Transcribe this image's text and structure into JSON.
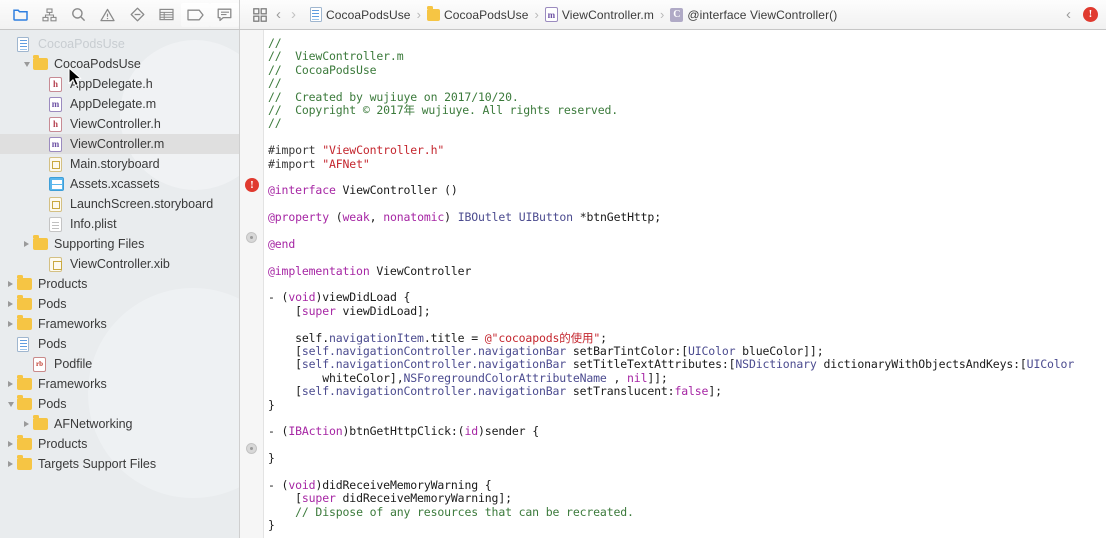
{
  "toolbar": {
    "icons": [
      {
        "name": "project-navigator-icon",
        "label": "Project Navigator",
        "active": true
      },
      {
        "name": "symbol-navigator-icon",
        "label": "Symbol Navigator",
        "active": false
      },
      {
        "name": "find-navigator-icon",
        "label": "Find Navigator",
        "active": false
      },
      {
        "name": "issue-navigator-icon",
        "label": "Issue Navigator",
        "active": false
      },
      {
        "name": "test-navigator-icon",
        "label": "Test Navigator",
        "active": false
      },
      {
        "name": "debug-navigator-icon",
        "label": "Debug Navigator",
        "active": false
      },
      {
        "name": "breakpoint-navigator-icon",
        "label": "Breakpoint Navigator",
        "active": false
      },
      {
        "name": "report-navigator-icon",
        "label": "Report Navigator",
        "active": false
      }
    ]
  },
  "jumpbar": {
    "related_items_label": "Related Items",
    "back_label": "Back",
    "forward_label": "Forward",
    "breadcrumbs": [
      {
        "label": "CocoaPodsUse",
        "icon": "project-icon"
      },
      {
        "label": "CocoaPodsUse",
        "icon": "folder-icon"
      },
      {
        "label": "ViewController.m",
        "icon": "objc-implementation-icon"
      },
      {
        "label": "@interface ViewController()",
        "icon": "class-icon"
      }
    ],
    "separator": "›",
    "issue_prev_label": "Previous Issue",
    "error_count": "!"
  },
  "sidebar": {
    "items": [
      {
        "label": "CocoaPodsUse",
        "indent": 0,
        "icon": "project-icon",
        "disclosure": "none",
        "selected": false,
        "faded": true
      },
      {
        "label": "CocoaPodsUse",
        "indent": 1,
        "icon": "folder-icon",
        "disclosure": "open",
        "selected": false,
        "faded": false
      },
      {
        "label": "AppDelegate.h",
        "indent": 2,
        "icon": "objc-header-icon",
        "disclosure": "none",
        "selected": false,
        "faded": false
      },
      {
        "label": "AppDelegate.m",
        "indent": 2,
        "icon": "objc-implementation-icon",
        "disclosure": "none",
        "selected": false,
        "faded": false
      },
      {
        "label": "ViewController.h",
        "indent": 2,
        "icon": "objc-header-icon",
        "disclosure": "none",
        "selected": false,
        "faded": false
      },
      {
        "label": "ViewController.m",
        "indent": 2,
        "icon": "objc-implementation-icon",
        "disclosure": "none",
        "selected": true,
        "faded": false
      },
      {
        "label": "Main.storyboard",
        "indent": 2,
        "icon": "storyboard-icon",
        "disclosure": "none",
        "selected": false,
        "faded": false
      },
      {
        "label": "Assets.xcassets",
        "indent": 2,
        "icon": "assets-icon",
        "disclosure": "none",
        "selected": false,
        "faded": false
      },
      {
        "label": "LaunchScreen.storyboard",
        "indent": 2,
        "icon": "storyboard-icon",
        "disclosure": "none",
        "selected": false,
        "faded": false
      },
      {
        "label": "Info.plist",
        "indent": 2,
        "icon": "plist-icon",
        "disclosure": "none",
        "selected": false,
        "faded": false
      },
      {
        "label": "Supporting Files",
        "indent": 1,
        "icon": "folder-icon",
        "disclosure": "closed",
        "selected": false,
        "faded": false
      },
      {
        "label": "ViewController.xib",
        "indent": 2,
        "icon": "xib-icon",
        "disclosure": "none",
        "selected": false,
        "faded": false
      },
      {
        "label": "Products",
        "indent": 0,
        "icon": "folder-icon",
        "disclosure": "closed",
        "selected": false,
        "faded": false
      },
      {
        "label": "Pods",
        "indent": 0,
        "icon": "folder-icon",
        "disclosure": "closed",
        "selected": false,
        "faded": false
      },
      {
        "label": "Frameworks",
        "indent": 0,
        "icon": "folder-icon",
        "disclosure": "closed",
        "selected": false,
        "faded": false
      },
      {
        "label": "Pods",
        "indent": 0,
        "icon": "project-icon",
        "disclosure": "none",
        "selected": false,
        "faded": false
      },
      {
        "label": "Podfile",
        "indent": 1,
        "icon": "ruby-icon",
        "disclosure": "none",
        "selected": false,
        "faded": false
      },
      {
        "label": "Frameworks",
        "indent": 0,
        "icon": "folder-icon",
        "disclosure": "closed",
        "selected": false,
        "faded": false
      },
      {
        "label": "Pods",
        "indent": 0,
        "icon": "folder-icon",
        "disclosure": "open",
        "selected": false,
        "faded": false
      },
      {
        "label": "AFNetworking",
        "indent": 1,
        "icon": "folder-icon",
        "disclosure": "closed",
        "selected": false,
        "faded": false
      },
      {
        "label": "Products",
        "indent": 0,
        "icon": "folder-icon",
        "disclosure": "closed",
        "selected": false,
        "faded": false
      },
      {
        "label": "Targets Support Files",
        "indent": 0,
        "icon": "folder-icon",
        "disclosure": "closed",
        "selected": false,
        "faded": false
      }
    ]
  },
  "editor": {
    "filename": "ViewController.m",
    "gutter": {
      "error_marker": "!",
      "breakpoint_dots": 2
    },
    "lines": [
      [
        [
          "cmt",
          "//"
        ]
      ],
      [
        [
          "cmt",
          "//  ViewController.m"
        ]
      ],
      [
        [
          "cmt",
          "//  CocoaPodsUse"
        ]
      ],
      [
        [
          "cmt",
          "//"
        ]
      ],
      [
        [
          "cmt",
          "//  Created by wujiuye on 2017/10/20."
        ]
      ],
      [
        [
          "cmt",
          "//  Copyright © 2017年 wujiuye. All rights reserved."
        ]
      ],
      [
        [
          "cmt",
          "//"
        ]
      ],
      [],
      [
        [
          "pre",
          "#import "
        ],
        [
          "str",
          "\"ViewController.h\""
        ]
      ],
      [
        [
          "pre",
          "#import "
        ],
        [
          "str",
          "\"AFNet\""
        ]
      ],
      [],
      [
        [
          "kw",
          "@interface"
        ],
        [
          "plain",
          " ViewController ()"
        ]
      ],
      [],
      [
        [
          "kw",
          "@property"
        ],
        [
          "plain",
          " ("
        ],
        [
          "kw",
          "weak"
        ],
        [
          "plain",
          ", "
        ],
        [
          "kw",
          "nonatomic"
        ],
        [
          "plain",
          ") "
        ],
        [
          "typ",
          "IBOutlet"
        ],
        [
          "plain",
          " "
        ],
        [
          "typ",
          "UIButton"
        ],
        [
          "plain",
          " *btnGetHttp;"
        ]
      ],
      [],
      [
        [
          "kw",
          "@end"
        ]
      ],
      [],
      [
        [
          "kw",
          "@implementation"
        ],
        [
          "plain",
          " ViewController"
        ]
      ],
      [],
      [
        [
          "plain",
          "- ("
        ],
        [
          "kw",
          "void"
        ],
        [
          "plain",
          ")viewDidLoad {"
        ]
      ],
      [
        [
          "plain",
          "    ["
        ],
        [
          "kw",
          "super"
        ],
        [
          "plain",
          " viewDidLoad];"
        ]
      ],
      [],
      [
        [
          "plain",
          "    self."
        ],
        [
          "typ",
          "navigationItem"
        ],
        [
          "plain",
          ".title = "
        ],
        [
          "str",
          "@\"cocoapods的使用\""
        ],
        [
          "plain",
          ";"
        ]
      ],
      [
        [
          "plain",
          "    ["
        ],
        [
          "typ",
          "self.navigationController.navigationBar"
        ],
        [
          "plain",
          " setBarTintColor:["
        ],
        [
          "typ",
          "UIColor"
        ],
        [
          "plain",
          " blueColor]];"
        ]
      ],
      [
        [
          "plain",
          "    ["
        ],
        [
          "typ",
          "self.navigationController.navigationBar"
        ],
        [
          "plain",
          " setTitleTextAttributes:["
        ],
        [
          "typ",
          "NSDictionary"
        ],
        [
          "plain",
          " dictionaryWithObjectsAndKeys:["
        ],
        [
          "typ",
          "UIColor"
        ]
      ],
      [
        [
          "plain",
          "        whiteColor],"
        ],
        [
          "typ",
          "NSForegroundColorAttributeName"
        ],
        [
          "plain",
          " , "
        ],
        [
          "kw",
          "nil"
        ],
        [
          "plain",
          "]];"
        ]
      ],
      [
        [
          "plain",
          "    ["
        ],
        [
          "typ",
          "self.navigationController.navigationBar"
        ],
        [
          "plain",
          " setTranslucent:"
        ],
        [
          "kw",
          "false"
        ],
        [
          "plain",
          "];"
        ]
      ],
      [
        [
          "plain",
          "}"
        ]
      ],
      [],
      [
        [
          "plain",
          "- ("
        ],
        [
          "kw",
          "IBAction"
        ],
        [
          "plain",
          ")btnGetHttpClick:("
        ],
        [
          "kw",
          "id"
        ],
        [
          "plain",
          ")sender {"
        ]
      ],
      [],
      [
        [
          "plain",
          "}"
        ]
      ],
      [],
      [
        [
          "plain",
          "- ("
        ],
        [
          "kw",
          "void"
        ],
        [
          "plain",
          ")didReceiveMemoryWarning {"
        ]
      ],
      [
        [
          "plain",
          "    ["
        ],
        [
          "kw",
          "super"
        ],
        [
          "plain",
          " didReceiveMemoryWarning];"
        ]
      ],
      [
        [
          "plain",
          "    "
        ],
        [
          "cmt",
          "// Dispose of any resources that can be recreated."
        ]
      ],
      [
        [
          "plain",
          "}"
        ]
      ]
    ]
  },
  "colors": {
    "comment": "#3b7a3b",
    "string": "#c4262e",
    "keyword": "#a626a4",
    "type": "#4b4b8f",
    "plain": "#1a1a1a",
    "error": "#e03a2f",
    "accent": "#2f7fe0",
    "sidebar_bg": "#e9ecee",
    "selection": "#dfdfdf"
  }
}
